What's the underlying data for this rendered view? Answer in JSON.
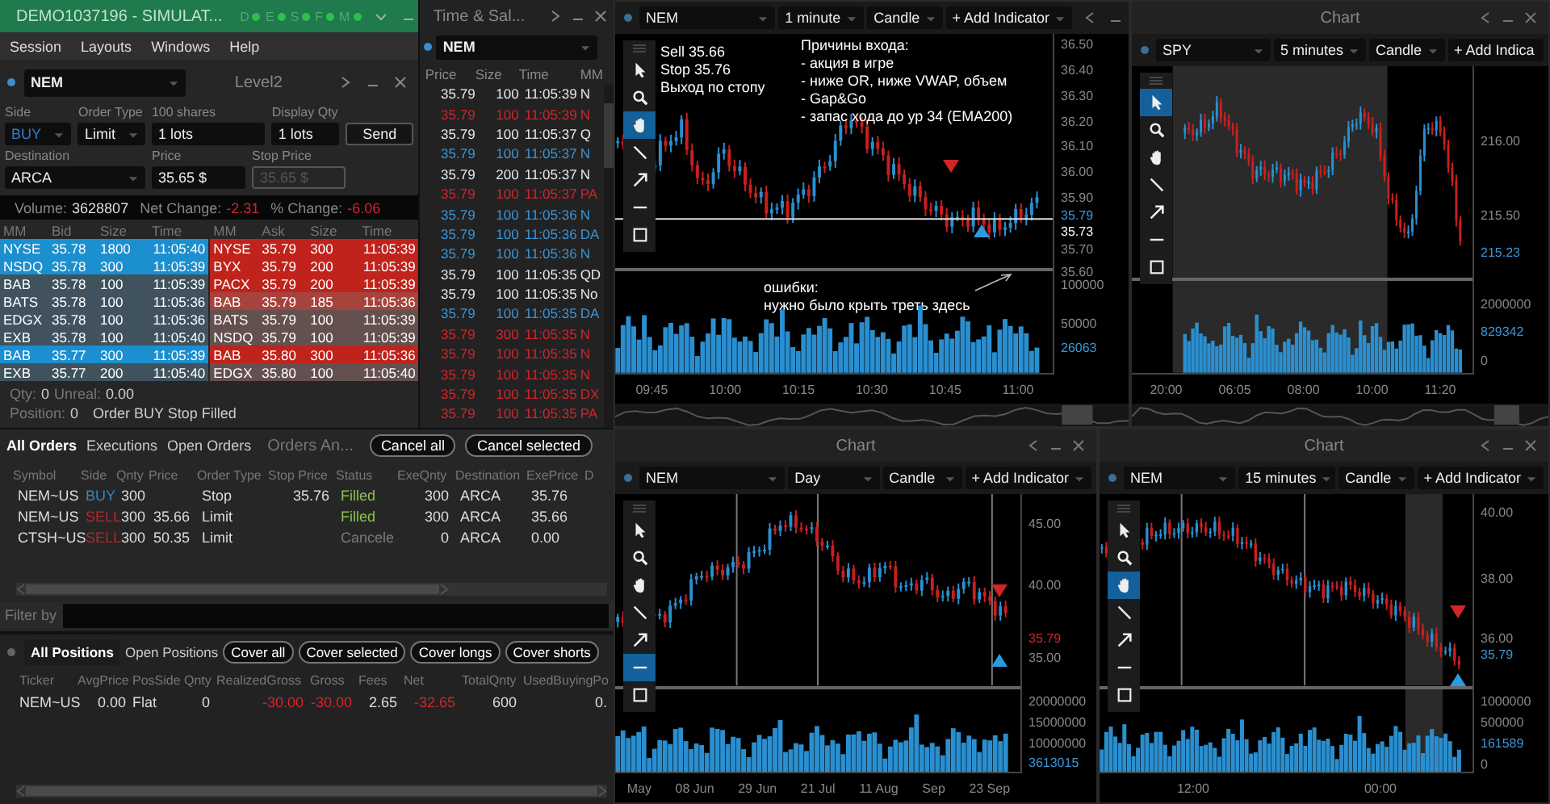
{
  "level2": {
    "title": "DEMO1037196 - SIMULAT...",
    "indicators": [
      {
        "letter": "D",
        "color": "#2fbf4f"
      },
      {
        "letter": "E",
        "color": "#2fbf4f"
      },
      {
        "letter": "S",
        "color": "#2fbf4f"
      },
      {
        "letter": "F",
        "color": "#2fbf4f"
      },
      {
        "letter": "M",
        "color": "#2fbf4f"
      }
    ],
    "menu": [
      "Session",
      "Layouts",
      "Windows",
      "Help"
    ],
    "symbol": "NEM",
    "panel_title": "Level2",
    "form": {
      "side_label": "Side",
      "side": "BUY",
      "order_type_label": "Order Type",
      "order_type": "Limit",
      "shares_label": "100 shares",
      "shares": "1 lots",
      "display_label": "Display Qty",
      "display": "1 lots",
      "send": "Send",
      "destination_label": "Destination",
      "destination": "ARCA",
      "price_label": "Price",
      "price": "35.65 $",
      "stop_label": "Stop Price",
      "stop": "35.65 $",
      "stop_disabled": true
    },
    "stats": [
      {
        "label": "Volume:",
        "value": "3628807",
        "negative": false
      },
      {
        "label": "Net Change:",
        "value": "-2.31",
        "negative": true
      },
      {
        "label": "% Change:",
        "value": "-6.06",
        "negative": true
      }
    ],
    "bid_columns": [
      "MM",
      "Bid",
      "Size",
      "Time"
    ],
    "ask_columns": [
      "MM",
      "Ask",
      "Size",
      "Time"
    ],
    "bids": [
      {
        "mm": "NYSE",
        "price": "35.78",
        "size": "1800",
        "time": "11:05:40",
        "color": "#1b8fcf"
      },
      {
        "mm": "NSDQ",
        "price": "35.78",
        "size": "300",
        "time": "11:05:39",
        "color": "#1b8fcf"
      },
      {
        "mm": "BAB",
        "price": "35.78",
        "size": "100",
        "time": "11:05:39",
        "color": "#3f525e"
      },
      {
        "mm": "BATS",
        "price": "35.78",
        "size": "100",
        "time": "11:05:36",
        "color": "#3f525e"
      },
      {
        "mm": "EDGX",
        "price": "35.78",
        "size": "100",
        "time": "11:05:36",
        "color": "#3f525e"
      },
      {
        "mm": "EXB",
        "price": "35.78",
        "size": "100",
        "time": "11:05:40",
        "color": "#3f525e"
      },
      {
        "mm": "BAB",
        "price": "35.77",
        "size": "300",
        "time": "11:05:39",
        "color": "#1b8fcf"
      },
      {
        "mm": "EXB",
        "price": "35.77",
        "size": "200",
        "time": "11:05:40",
        "color": "#3f525e"
      }
    ],
    "asks": [
      {
        "mm": "NYSE",
        "price": "35.79",
        "size": "300",
        "time": "11:05:39",
        "color": "#c0231b"
      },
      {
        "mm": "BYX",
        "price": "35.79",
        "size": "200",
        "time": "11:05:39",
        "color": "#c0231b"
      },
      {
        "mm": "PACX",
        "price": "35.79",
        "size": "200",
        "time": "11:05:39",
        "color": "#c0231b"
      },
      {
        "mm": "BAB",
        "price": "35.79",
        "size": "185",
        "time": "11:05:36",
        "color": "#a6433d"
      },
      {
        "mm": "BATS",
        "price": "35.79",
        "size": "100",
        "time": "11:05:39",
        "color": "#64504f"
      },
      {
        "mm": "NSDQ",
        "price": "35.79",
        "size": "100",
        "time": "11:05:39",
        "color": "#64504f"
      },
      {
        "mm": "BAB",
        "price": "35.80",
        "size": "300",
        "time": "11:05:36",
        "color": "#c0231b"
      },
      {
        "mm": "EDGX",
        "price": "35.80",
        "size": "100",
        "time": "11:05:40",
        "color": "#64504f"
      }
    ],
    "qty_line": [
      {
        "label": "Qty:",
        "value": "0"
      },
      {
        "label": "Unreal:",
        "value": "0.00"
      }
    ],
    "position_line": {
      "label": "Position:",
      "value": "0",
      "message": "Order BUY Stop Filled"
    }
  },
  "time_sales": {
    "title": "Time & Sal...",
    "symbol": "NEM",
    "columns": [
      "Price",
      "Size",
      "Time",
      "MM"
    ],
    "rows": [
      {
        "price": "35.79",
        "size": "100",
        "time": "11:05:39",
        "mm": "N",
        "color": "#e8e8e8"
      },
      {
        "price": "35.79",
        "size": "100",
        "time": "11:05:39",
        "mm": "N",
        "color": "#d0262a"
      },
      {
        "price": "35.79",
        "size": "100",
        "time": "11:05:37",
        "mm": "Q",
        "color": "#e8e8e8"
      },
      {
        "price": "35.79",
        "size": "100",
        "time": "11:05:37",
        "mm": "N",
        "color": "#3a95d8"
      },
      {
        "price": "35.79",
        "size": "200",
        "time": "11:05:37",
        "mm": "N",
        "color": "#e8e8e8"
      },
      {
        "price": "35.79",
        "size": "100",
        "time": "11:05:37",
        "mm": "PA",
        "color": "#d0262a"
      },
      {
        "price": "35.79",
        "size": "100",
        "time": "11:05:36",
        "mm": "N",
        "color": "#3a95d8"
      },
      {
        "price": "35.79",
        "size": "100",
        "time": "11:05:36",
        "mm": "DA",
        "color": "#3a95d8"
      },
      {
        "price": "35.79",
        "size": "100",
        "time": "11:05:36",
        "mm": "N",
        "color": "#3a95d8"
      },
      {
        "price": "35.79",
        "size": "100",
        "time": "11:05:35",
        "mm": "QD",
        "color": "#e8e8e8"
      },
      {
        "price": "35.79",
        "size": "100",
        "time": "11:05:35",
        "mm": "No",
        "color": "#e8e8e8"
      },
      {
        "price": "35.79",
        "size": "100",
        "time": "11:05:35",
        "mm": "DA",
        "color": "#3a95d8"
      },
      {
        "price": "35.79",
        "size": "300",
        "time": "11:05:35",
        "mm": "N",
        "color": "#d0262a"
      },
      {
        "price": "35.79",
        "size": "100",
        "time": "11:05:35",
        "mm": "N",
        "color": "#d0262a"
      },
      {
        "price": "35.79",
        "size": "100",
        "time": "11:05:35",
        "mm": "N",
        "color": "#d0262a"
      },
      {
        "price": "35.79",
        "size": "100",
        "time": "11:05:35",
        "mm": "DX",
        "color": "#d0262a"
      },
      {
        "price": "35.79",
        "size": "100",
        "time": "11:05:35",
        "mm": "PA",
        "color": "#d0262a"
      }
    ]
  },
  "orders": {
    "tabs": [
      {
        "label": "All Orders",
        "selected": true
      },
      {
        "label": "Executions",
        "selected": false
      },
      {
        "label": "Open Orders",
        "selected": false
      }
    ],
    "title": "Orders An...",
    "buttons": [
      "Cancel all",
      "Cancel selected"
    ],
    "columns": [
      "Symbol",
      "Side",
      "Qnty",
      "Price",
      "Order Type",
      "Stop Price",
      "Status",
      "ExeQnty",
      "Destination",
      "ExePrice",
      "D"
    ],
    "rows": [
      {
        "symbol": "NEM~US",
        "side": {
          "text": "BUY",
          "color": "#2f86c8"
        },
        "qnty": "300",
        "order_type": "Stop",
        "stop_price": "35.76",
        "status": {
          "text": "Filled",
          "color": "#8bc34a"
        },
        "exe_qnty": "300",
        "destination": "ARCA",
        "exe_price": "35.76"
      },
      {
        "symbol": "NEM~US",
        "side": {
          "text": "SELL",
          "color": "#b3262a"
        },
        "qnty": "300",
        "price": "35.66",
        "order_type": "Limit",
        "status": {
          "text": "Filled",
          "color": "#8bc34a"
        },
        "exe_qnty": "300",
        "destination": "ARCA",
        "exe_price": "35.66"
      },
      {
        "symbol": "CTSH~US",
        "side": {
          "text": "SELL",
          "color": "#b3262a"
        },
        "qnty": "300",
        "price": "50.35",
        "order_type": "Limit",
        "status": {
          "text": "Cancele",
          "color": "#7b7b7b"
        },
        "exe_qnty": "0",
        "destination": "ARCA",
        "exe_price": "0.00"
      }
    ],
    "filter_label": "Filter by"
  },
  "positions": {
    "tabs": [
      {
        "label": "All Positions",
        "selected": true
      },
      {
        "label": "Open Positions",
        "selected": false
      }
    ],
    "buttons": [
      "Cover all",
      "Cover selected",
      "Cover longs",
      "Cover shorts"
    ],
    "columns": [
      "Ticker",
      "AvgPrice",
      "PosSide",
      "Qnty",
      "RealizedGross",
      "Gross",
      "Fees",
      "Net",
      "TotalQnty",
      "UsedBuyingPo"
    ],
    "rows": [
      {
        "cells": [
          {
            "text": "NEM~US",
            "negative": false
          },
          {
            "text": "0.00",
            "negative": false
          },
          {
            "text": "Flat",
            "negative": false
          },
          {
            "text": "0",
            "negative": false
          },
          {
            "text": "-30.00",
            "negative": true
          },
          {
            "text": "-30.00",
            "negative": true
          },
          {
            "text": "2.65",
            "negative": false
          },
          {
            "text": "-32.65",
            "negative": true
          },
          {
            "text": "600",
            "negative": false
          },
          {
            "text": "0.",
            "negative": false
          }
        ]
      }
    ]
  },
  "charts": [
    {
      "symbol": "NEM",
      "interval": "1 minute",
      "type": "Candle",
      "add_indicator": "+ Add Indicator",
      "tools": [
        {
          "selected": false
        },
        {
          "selected": false
        },
        {
          "selected": true
        },
        {
          "selected": false
        },
        {
          "selected": false
        },
        {
          "selected": false
        },
        {
          "selected": false
        }
      ],
      "price_ticks": [
        "36.50",
        "36.40",
        "36.30",
        "36.20",
        "36.10",
        "36.00",
        "35.90",
        "35.70",
        "35.60"
      ],
      "volume_ticks": [
        "100000",
        "50000"
      ],
      "markers": [
        {
          "text": "35.79",
          "color": "#3a95d8"
        },
        {
          "text": "35.73",
          "color": "#ffffff"
        },
        {
          "text": "26063",
          "color": "#3a95d8"
        }
      ],
      "x_labels": [
        "09:45",
        "10:00",
        "10:15",
        "10:30",
        "10:45",
        "11:00"
      ],
      "notes": [
        {
          "lines": [
            "Sell 35.66",
            "Stop 35.76",
            "Выход по стопу"
          ]
        },
        {
          "lines": [
            "Причины входа:",
            "- акция в игре",
            "- ниже OR, ниже VWAP, объем",
            "- Gap&Go",
            "- запас хода до ур 34 (EMA200)"
          ]
        },
        {
          "lines": [
            "ошибки:",
            "нужно было крыть треть здесь"
          ]
        }
      ]
    },
    {
      "title": "Chart",
      "symbol": "SPY",
      "interval": "5 minutes",
      "type": "Candle",
      "add_indicator": "+ Add Indica",
      "tools": [
        {
          "selected": true
        },
        {
          "selected": false
        },
        {
          "selected": false
        },
        {
          "selected": false
        },
        {
          "selected": false
        },
        {
          "selected": false
        },
        {
          "selected": false
        }
      ],
      "price_ticks": [
        "216.00",
        "215.50"
      ],
      "volume_ticks": [
        "2000000",
        "0"
      ],
      "markers": [
        {
          "text": "215.23",
          "color": "#3a95d8"
        },
        {
          "text": "829342",
          "color": "#3a95d8"
        }
      ],
      "x_labels": [
        "20:00",
        "06:05",
        "08:00",
        "10:00",
        "11:20"
      ]
    },
    {
      "title": "Chart",
      "symbol": "NEM",
      "interval": "Day",
      "type": "Candle",
      "add_indicator": "+ Add Indicator",
      "tools": [
        {
          "selected": false
        },
        {
          "selected": false
        },
        {
          "selected": false
        },
        {
          "selected": false
        },
        {
          "selected": false
        },
        {
          "selected": true
        },
        {
          "selected": false
        }
      ],
      "price_ticks": [
        "45.00",
        "40.00",
        "35.00"
      ],
      "volume_ticks": [
        "20000000",
        "15000000",
        "10000000"
      ],
      "markers": [
        {
          "text": "35.79",
          "color": "#d0262a"
        },
        {
          "text": "3613015",
          "color": "#3a95d8"
        }
      ],
      "x_labels": [
        "May",
        "08 Jun",
        "29 Jun",
        "21 Jul",
        "11 Aug",
        "Sep",
        "23 Sep"
      ]
    },
    {
      "title": "Chart",
      "symbol": "NEM",
      "interval": "15 minutes",
      "type": "Candle",
      "add_indicator": "+ Add Indicator",
      "tools": [
        {
          "selected": false
        },
        {
          "selected": false
        },
        {
          "selected": true
        },
        {
          "selected": false
        },
        {
          "selected": false
        },
        {
          "selected": false
        },
        {
          "selected": false
        }
      ],
      "price_ticks": [
        "40.00",
        "38.00",
        "36.00"
      ],
      "volume_ticks": [
        "1000000",
        "500000",
        "0"
      ],
      "markers": [
        {
          "text": "35.79",
          "color": "#3a95d8"
        },
        {
          "text": "161589",
          "color": "#3a95d8"
        }
      ],
      "x_labels": [
        "12:00",
        "00:00"
      ]
    }
  ]
}
